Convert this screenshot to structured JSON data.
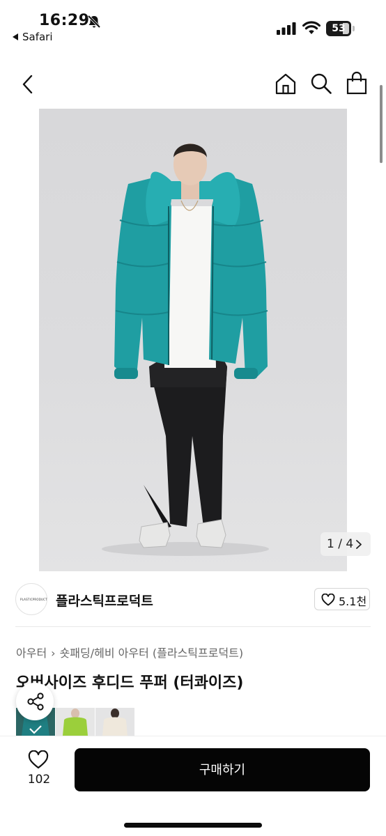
{
  "status_bar": {
    "time": "16:29",
    "back_app": "Safari",
    "battery": "53",
    "icons": [
      "bell-slash-icon",
      "signal-icon",
      "wifi-icon",
      "battery-icon"
    ]
  },
  "nav": {
    "icons": [
      "back-chevron-icon",
      "home-icon",
      "search-icon",
      "shopping-bag-icon"
    ]
  },
  "gallery": {
    "counter": "1 / 4",
    "image_alt": "Model wearing oversized teal hooded puffer jacket"
  },
  "brand": {
    "name": "플라스틱프로덕트",
    "logo_text": "PLASTICPRODUCT",
    "likes": "5.1천"
  },
  "breadcrumb": {
    "level1": "아우터",
    "level2": "숏패딩/헤비 아우터 (플라스틱프로덕트)"
  },
  "product": {
    "title": "오버사이즈 후디드 푸퍼 (터콰이즈)"
  },
  "color_options": [
    "turquoise",
    "lime",
    "cream"
  ],
  "bottom_bar": {
    "wish_count": "102",
    "buy_label": "구매하기"
  },
  "colors": {
    "jacket": "#22a0a4",
    "buy_button": "#050505",
    "lime": "#9bcf3b",
    "cream": "#efe8dc"
  }
}
